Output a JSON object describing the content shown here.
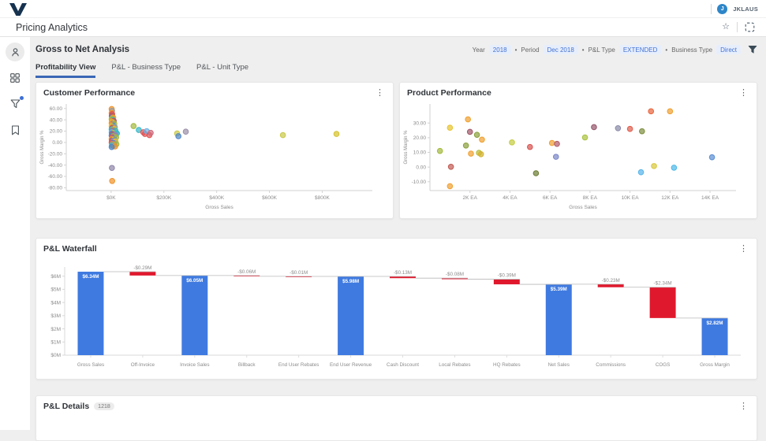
{
  "topbar": {
    "user": "JKLAUS",
    "avatar_initial": "J"
  },
  "pagebar": {
    "title": "Pricing Analytics"
  },
  "sidebar": {
    "icons": [
      "person-icon",
      "grid-icon",
      "filter-funnel-icon",
      "bookmark-icon"
    ]
  },
  "analysis": {
    "title": "Gross to Net Analysis",
    "filters": {
      "separator": "•",
      "items": [
        {
          "label": "Year",
          "value": "2018"
        },
        {
          "label": "Period",
          "value": "Dec 2018"
        },
        {
          "label": "P&L Type",
          "value": "EXTENDED"
        },
        {
          "label": "Business Type",
          "value": "Direct"
        }
      ]
    },
    "tabs": [
      {
        "label": "Profitability View",
        "active": true
      },
      {
        "label": "P&L - Business Type",
        "active": false
      },
      {
        "label": "P&L - Unit Type",
        "active": false
      }
    ]
  },
  "cards": {
    "customer": {
      "title": "Customer Performance"
    },
    "product": {
      "title": "Product Performance"
    },
    "waterfall": {
      "title": "P&L Waterfall"
    },
    "details": {
      "title": "P&L Details",
      "count": "1218"
    }
  },
  "ui": {
    "kebab": "⋮",
    "star": "☆"
  },
  "chart_data": [
    {
      "type": "scatter",
      "target": "customer",
      "title": "Customer Performance",
      "xlabel": "Gross Sales",
      "ylabel": "Gross Margin %",
      "xlim": [
        -170,
        990
      ],
      "ylim": [
        -85,
        68
      ],
      "xticks": [
        [
          0,
          "$0K"
        ],
        [
          200,
          "$200K"
        ],
        [
          400,
          "$400K"
        ],
        [
          600,
          "$600K"
        ],
        [
          800,
          "$800K"
        ]
      ],
      "yticks": [
        [
          60,
          "60.00"
        ],
        [
          40,
          "40.00"
        ],
        [
          20,
          "20.00"
        ],
        [
          0,
          "0.00"
        ],
        [
          -20,
          "-20.00"
        ],
        [
          -40,
          "-40.00"
        ],
        [
          -60,
          "-60.00"
        ],
        [
          -80,
          "-80.00"
        ]
      ],
      "points": [
        [
          2,
          59,
          "#f0932b"
        ],
        [
          3.5,
          56,
          "#9b9b9b"
        ],
        [
          2,
          52,
          "#f0932b"
        ],
        [
          4,
          50,
          "#e05352"
        ],
        [
          2.5,
          47,
          "#b25563"
        ],
        [
          3.5,
          44,
          "#4f86c6"
        ],
        [
          5,
          43,
          "#f0932b"
        ],
        [
          8,
          44,
          "#e7a12e"
        ],
        [
          2,
          41,
          "#a2b93c"
        ],
        [
          6,
          40,
          "#35b8c8"
        ],
        [
          3,
          38,
          "#f0932b"
        ],
        [
          10,
          38,
          "#b25563"
        ],
        [
          4,
          36,
          "#e7c32e"
        ],
        [
          2,
          34,
          "#f0932b"
        ],
        [
          6,
          33,
          "#9b7bb8"
        ],
        [
          12,
          33,
          "#a2b93c"
        ],
        [
          3,
          31,
          "#f0932b"
        ],
        [
          7,
          30,
          "#4f86c6"
        ],
        [
          2,
          29,
          "#e7c32e"
        ],
        [
          9,
          28,
          "#35b8c8"
        ],
        [
          5,
          27,
          "#f0932b"
        ],
        [
          14,
          27,
          "#9b9b9b"
        ],
        [
          3,
          25,
          "#b25563"
        ],
        [
          11,
          24,
          "#e7c32e"
        ],
        [
          2,
          23,
          "#35b8c8"
        ],
        [
          7,
          22,
          "#f0932b"
        ],
        [
          16,
          21,
          "#35b8c8"
        ],
        [
          4,
          20,
          "#4f86c6"
        ],
        [
          9,
          19,
          "#e05352"
        ],
        [
          2,
          18,
          "#6db3e8"
        ],
        [
          13,
          18,
          "#35b8c8"
        ],
        [
          6,
          17,
          "#e7c32e"
        ],
        [
          18,
          17,
          "#49c0d8"
        ],
        [
          3,
          16,
          "#4f86c6"
        ],
        [
          10,
          15,
          "#f0932b"
        ],
        [
          22,
          16,
          "#35b8c8"
        ],
        [
          5,
          14,
          "#b25563"
        ],
        [
          15,
          13,
          "#9b7bb8"
        ],
        [
          2,
          12,
          "#4f86c6"
        ],
        [
          8,
          11,
          "#a2b93c"
        ],
        [
          12,
          10,
          "#9b9b9b"
        ],
        [
          4,
          9,
          "#e05352"
        ],
        [
          19,
          9,
          "#a2b93c"
        ],
        [
          6,
          7,
          "#4f86c6"
        ],
        [
          2,
          6,
          "#f0932b"
        ],
        [
          10,
          5,
          "#e7c32e"
        ],
        [
          14,
          4,
          "#4f86c6"
        ],
        [
          3,
          3,
          "#b25563"
        ],
        [
          7,
          2,
          "#6db3e8"
        ],
        [
          17,
          2,
          "#e7c32e"
        ],
        [
          2,
          0,
          "#e05352"
        ],
        [
          9,
          -1,
          "#4f86c6"
        ],
        [
          12,
          -2,
          "#9b7bb8"
        ],
        [
          5,
          -3,
          "#f0932b"
        ],
        [
          20,
          -3,
          "#a2b93c"
        ],
        [
          3,
          -5,
          "#35b8c8"
        ],
        [
          8,
          -6,
          "#9b9b9b"
        ],
        [
          15,
          -7,
          "#f0932b"
        ],
        [
          2,
          -8,
          "#4f86c6"
        ],
        [
          85,
          29,
          "#a2b93c"
        ],
        [
          105,
          22,
          "#35b8c8"
        ],
        [
          122,
          18,
          "#e05352"
        ],
        [
          128,
          15,
          "#e05352"
        ],
        [
          135,
          20,
          "#6db3e8"
        ],
        [
          145,
          13,
          "#e05352"
        ],
        [
          150,
          17,
          "#d06a7a"
        ],
        [
          250,
          16,
          "#c9c94a"
        ],
        [
          255,
          11,
          "#4f86c6"
        ],
        [
          283,
          19,
          "#9b8fa8"
        ],
        [
          3,
          -45,
          "#8f86a8"
        ],
        [
          4,
          -68,
          "#f0932b"
        ],
        [
          651,
          13,
          "#c9c94a"
        ],
        [
          854,
          15,
          "#d6c22e"
        ]
      ]
    },
    {
      "type": "scatter",
      "target": "product",
      "title": "Product Performance",
      "xlabel": "Gross Sales",
      "ylabel": "Gross Margin %",
      "xlim": [
        0,
        15.3
      ],
      "ylim": [
        -16,
        43
      ],
      "xticks": [
        [
          2,
          "2K EA"
        ],
        [
          4,
          "4K EA"
        ],
        [
          6,
          "6K EA"
        ],
        [
          8,
          "8K EA"
        ],
        [
          10,
          "10K EA"
        ],
        [
          12,
          "12K EA"
        ],
        [
          14,
          "14K EA"
        ]
      ],
      "yticks": [
        [
          30,
          "30.00"
        ],
        [
          20,
          "20.00"
        ],
        [
          10,
          "10.00"
        ],
        [
          0,
          "0.00"
        ],
        [
          -10,
          "-10.00"
        ]
      ],
      "points": [
        [
          0.5,
          11,
          "#a2b93c"
        ],
        [
          1.0,
          26.8,
          "#e7c32e"
        ],
        [
          1.05,
          0.2,
          "#c05a52"
        ],
        [
          1.0,
          -13,
          "#f0a030"
        ],
        [
          1.9,
          32.5,
          "#f0a030"
        ],
        [
          2.0,
          24,
          "#a05668"
        ],
        [
          2.05,
          9.2,
          "#f0a030"
        ],
        [
          1.8,
          14.7,
          "#8aa03c"
        ],
        [
          2.35,
          22,
          "#8aa03c"
        ],
        [
          2.6,
          18.7,
          "#f0a030"
        ],
        [
          2.45,
          9.7,
          "#b5bd3a"
        ],
        [
          2.55,
          8.8,
          "#d4b12e"
        ],
        [
          4.1,
          16.8,
          "#c3cc3e"
        ],
        [
          5.0,
          13.7,
          "#d9534f"
        ],
        [
          5.3,
          -4.2,
          "#6b7d32"
        ],
        [
          6.1,
          16.4,
          "#f0a030"
        ],
        [
          6.35,
          15.8,
          "#b05a6a"
        ],
        [
          6.3,
          7.0,
          "#7b86c8"
        ],
        [
          7.75,
          20.2,
          "#a9c23f"
        ],
        [
          8.2,
          27.2,
          "#96566b"
        ],
        [
          9.4,
          26.5,
          "#8a8aa8"
        ],
        [
          10.0,
          26,
          "#e05c4b"
        ],
        [
          10.6,
          24.4,
          "#7d8f3e"
        ],
        [
          10.55,
          -3.5,
          "#56b4e9"
        ],
        [
          11.05,
          38,
          "#e8643c"
        ],
        [
          11.2,
          0.7,
          "#d8c73c"
        ],
        [
          12.0,
          38,
          "#f0a030"
        ],
        [
          12.2,
          -0.4,
          "#4db8e8"
        ],
        [
          14.1,
          6.7,
          "#5b8fd4"
        ]
      ]
    },
    {
      "type": "waterfall",
      "target": "waterfall",
      "title": "P&L Waterfall",
      "ylim": [
        0,
        6.7
      ],
      "yticks": [
        [
          0,
          "$0M"
        ],
        [
          1,
          "$1M"
        ],
        [
          2,
          "$2M"
        ],
        [
          3,
          "$3M"
        ],
        [
          4,
          "$4M"
        ],
        [
          5,
          "$5M"
        ],
        [
          6,
          "$6M"
        ]
      ],
      "colors": {
        "total": "#3f7ae0",
        "delta": "#e0182d"
      },
      "items": [
        {
          "label": "Gross Sales",
          "value": 6.34,
          "kind": "total",
          "display": "$6.34M"
        },
        {
          "label": "Off-Invoice",
          "value": -0.29,
          "kind": "delta",
          "display": "-$0.29M"
        },
        {
          "label": "Invoice Sales",
          "value": 6.05,
          "kind": "total",
          "display": "$6.05M"
        },
        {
          "label": "Billback",
          "value": -0.06,
          "kind": "delta",
          "display": "-$0.06M"
        },
        {
          "label": "End User Rebates",
          "value": -0.01,
          "kind": "delta",
          "display": "-$0.01M"
        },
        {
          "label": "End User Revenue",
          "value": 5.98,
          "kind": "total",
          "display": "$5.98M"
        },
        {
          "label": "Cash Discount",
          "value": -0.13,
          "kind": "delta",
          "display": "-$0.13M"
        },
        {
          "label": "Local Rebates",
          "value": -0.08,
          "kind": "delta",
          "display": "-$0.08M"
        },
        {
          "label": "HQ Rebates",
          "value": -0.39,
          "kind": "delta",
          "display": "-$0.39M"
        },
        {
          "label": "Net Sales",
          "value": 5.39,
          "kind": "total",
          "display": "$5.39M"
        },
        {
          "label": "Commissions",
          "value": -0.23,
          "kind": "delta",
          "display": "-$0.23M"
        },
        {
          "label": "COGS",
          "value": -2.34,
          "kind": "delta",
          "display": "-$2.34M"
        },
        {
          "label": "Gross Margin",
          "value": 2.82,
          "kind": "total",
          "display": "$2.82M"
        }
      ]
    }
  ]
}
